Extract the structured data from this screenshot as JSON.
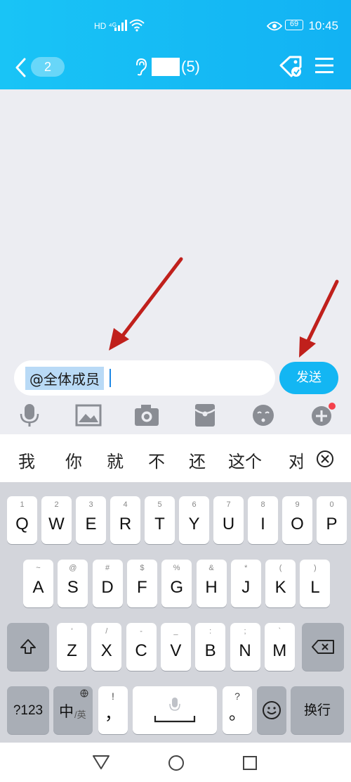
{
  "status_bar": {
    "network_badges": "HD ⁴ᴳ",
    "battery": "69",
    "time": "10:45"
  },
  "header": {
    "unread_count": "2",
    "member_count": "(5)"
  },
  "input": {
    "value": "@全体成员",
    "send_label": "发送"
  },
  "candidates": [
    "我",
    "你",
    "就",
    "不",
    "还",
    "这个",
    "对"
  ],
  "keyboard": {
    "row1": [
      {
        "key": "Q",
        "sub": "1"
      },
      {
        "key": "W",
        "sub": "2"
      },
      {
        "key": "E",
        "sub": "3"
      },
      {
        "key": "R",
        "sub": "4"
      },
      {
        "key": "T",
        "sub": "5"
      },
      {
        "key": "Y",
        "sub": "6"
      },
      {
        "key": "U",
        "sub": "7"
      },
      {
        "key": "I",
        "sub": "8"
      },
      {
        "key": "O",
        "sub": "9"
      },
      {
        "key": "P",
        "sub": "0"
      }
    ],
    "row2": [
      {
        "key": "A",
        "sub": "~"
      },
      {
        "key": "S",
        "sub": "@"
      },
      {
        "key": "D",
        "sub": "#"
      },
      {
        "key": "F",
        "sub": "$"
      },
      {
        "key": "G",
        "sub": "%"
      },
      {
        "key": "H",
        "sub": "&"
      },
      {
        "key": "J",
        "sub": "*"
      },
      {
        "key": "K",
        "sub": "("
      },
      {
        "key": "L",
        "sub": ")"
      }
    ],
    "row3": [
      {
        "key": "Z",
        "sub": "'"
      },
      {
        "key": "X",
        "sub": "/"
      },
      {
        "key": "C",
        "sub": "-"
      },
      {
        "key": "V",
        "sub": "_"
      },
      {
        "key": "B",
        "sub": ":"
      },
      {
        "key": "N",
        "sub": ";"
      },
      {
        "key": "M",
        "sub": "`"
      }
    ],
    "num_label": "?123",
    "lang_label_main": "中",
    "lang_label_sub": "/英",
    "comma_label": "，",
    "comma_sub": "!",
    "period_label": "。",
    "period_sub": "?",
    "enter_label": "换行"
  },
  "colors": {
    "header": "#12b2f3",
    "send_button": "#13b6f3",
    "selection": "#b9daf6",
    "arrow": "#c0201c"
  }
}
